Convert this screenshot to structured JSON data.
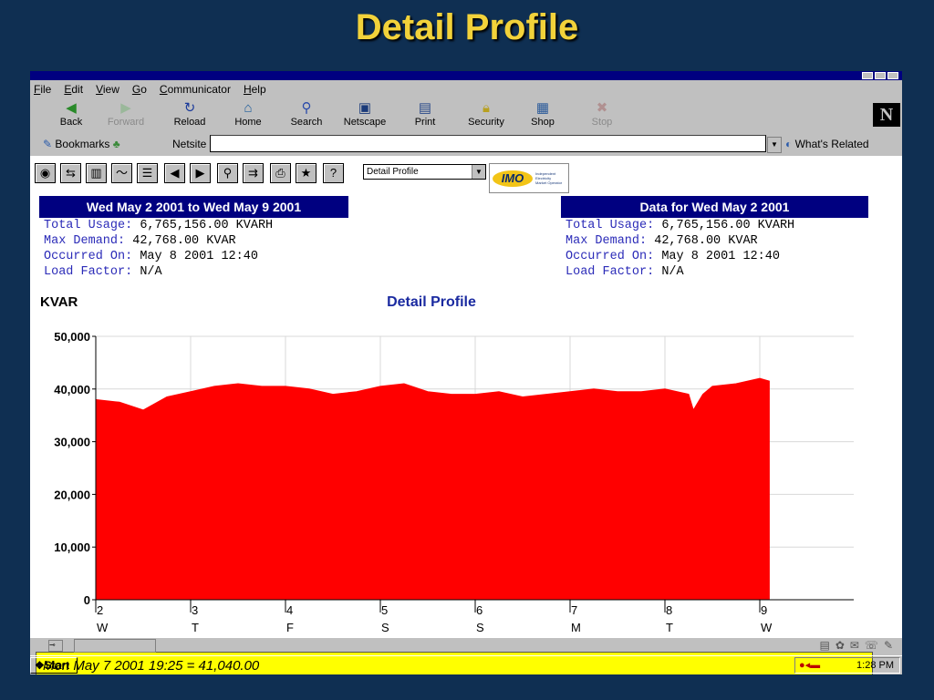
{
  "slide": {
    "title": "Detail Profile"
  },
  "menu": [
    "File",
    "Edit",
    "View",
    "Go",
    "Communicator",
    "Help"
  ],
  "nav_buttons": [
    {
      "label": "Back",
      "icon": "back-arrow-icon",
      "enabled": true
    },
    {
      "label": "Forward",
      "icon": "forward-arrow-icon",
      "enabled": false
    },
    {
      "label": "Reload",
      "icon": "reload-icon",
      "enabled": true
    },
    {
      "label": "Home",
      "icon": "home-icon",
      "enabled": true
    },
    {
      "label": "Search",
      "icon": "search-icon",
      "enabled": true
    },
    {
      "label": "Netscape",
      "icon": "netscape-icon",
      "enabled": true
    },
    {
      "label": "Print",
      "icon": "printer-icon",
      "enabled": true
    },
    {
      "label": "Security",
      "icon": "lock-icon",
      "enabled": true
    },
    {
      "label": "Shop",
      "icon": "shop-icon",
      "enabled": true
    },
    {
      "label": "Stop",
      "icon": "stop-icon",
      "enabled": false
    }
  ],
  "location": {
    "bookmarks": "Bookmarks",
    "netsite_label": "Netsite",
    "url": "",
    "whats_related": "What's Related"
  },
  "app_toolbar": {
    "icons": [
      "eye-icon",
      "compare-icon",
      "bar-chart-icon",
      "line-chart-icon",
      "table-icon",
      "left-arrow-icon",
      "right-arrow-icon",
      "zoom-icon",
      "export-icon",
      "print-icon",
      "star-icon",
      "help-icon"
    ],
    "profile_select": "Detail Profile",
    "logo_text": "IMO",
    "logo_subtext": [
      "Independent",
      "Electricity",
      "Market Operator"
    ]
  },
  "left_summary": {
    "header": "Wed May 2 2001 to Wed May 9 2001",
    "rows": [
      {
        "label": "Total Usage:",
        "value": "6,765,156.00 KVARH"
      },
      {
        "label": "Max Demand:",
        "value": "42,768.00 KVAR"
      },
      {
        "label": "Occurred On:",
        "value": "May 8 2001 12:40"
      },
      {
        "label": "Load Factor:",
        "value": "N/A"
      }
    ]
  },
  "right_summary": {
    "header": "Data for Wed May 2 2001",
    "rows": [
      {
        "label": "Total Usage:",
        "value": "6,765,156.00 KVARH"
      },
      {
        "label": "Max Demand:",
        "value": "42,768.00 KVAR"
      },
      {
        "label": "Occurred On:",
        "value": "May 8 2001 12:40"
      },
      {
        "label": "Load Factor:",
        "value": "N/A"
      }
    ]
  },
  "chart_data": {
    "type": "area",
    "title": "Detail Profile",
    "ylabel": "KVAR",
    "xlabel": "",
    "ylim": [
      0,
      50000
    ],
    "yticks": [
      "0",
      "10,000",
      "20,000",
      "30,000",
      "40,000",
      "50,000"
    ],
    "xticks": [
      {
        "day": "2",
        "weekday": "W"
      },
      {
        "day": "3",
        "weekday": "T"
      },
      {
        "day": "4",
        "weekday": "F"
      },
      {
        "day": "5",
        "weekday": "S"
      },
      {
        "day": "6",
        "weekday": "S"
      },
      {
        "day": "7",
        "weekday": "M"
      },
      {
        "day": "8",
        "weekday": "T"
      },
      {
        "day": "9",
        "weekday": "W"
      }
    ],
    "grid": true,
    "series": [
      {
        "color": "#ff0000",
        "x_days": [
          0,
          0.25,
          0.5,
          0.75,
          1.0,
          1.25,
          1.5,
          1.75,
          2.0,
          2.25,
          2.5,
          2.75,
          3.0,
          3.25,
          3.5,
          3.75,
          4.0,
          4.25,
          4.5,
          4.75,
          5.0,
          5.25,
          5.5,
          5.75,
          6.0,
          6.25,
          6.3,
          6.4,
          6.5,
          6.75,
          7.0,
          7.1
        ],
        "values": [
          38000,
          37500,
          36000,
          38500,
          39500,
          40500,
          41000,
          40500,
          40500,
          40000,
          39000,
          39500,
          40500,
          41000,
          39500,
          39000,
          39000,
          39500,
          38500,
          39000,
          39500,
          40000,
          39500,
          39500,
          40000,
          39000,
          36000,
          39000,
          40500,
          41000,
          42000,
          41500
        ]
      }
    ]
  },
  "readout": "Mon May 7 2001 19:25 = 41,040.00",
  "taskbar": {
    "start": "Start",
    "clock": "1:28 PM"
  }
}
